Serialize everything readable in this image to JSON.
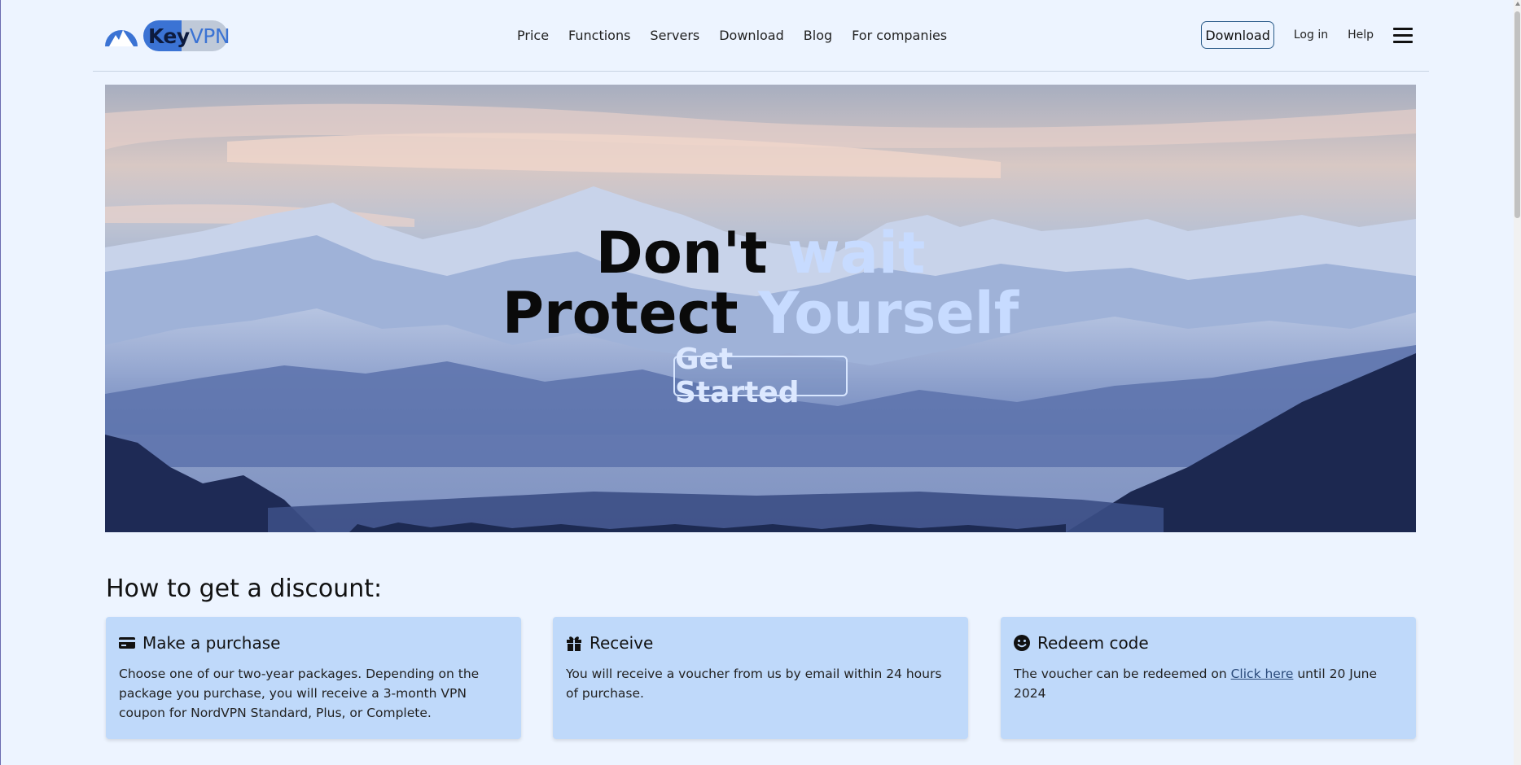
{
  "logo": {
    "key": "Key",
    "vpn": "VPN"
  },
  "nav": {
    "items": [
      "Price",
      "Functions",
      "Servers",
      "Download",
      "Blog",
      "For companies"
    ]
  },
  "right_nav": {
    "download": "Download",
    "login": "Log in",
    "help": "Help"
  },
  "hero": {
    "line1_a": "Don't ",
    "line1_b": "wait",
    "line2_a": "Protect ",
    "line2_b": "Yourself",
    "cta": "Get Started"
  },
  "discount": {
    "title": "How to get a discount:",
    "cards": [
      {
        "icon": "credit-card-icon",
        "title": "Make a purchase",
        "text": "Choose one of our two-year packages. Depending on the package you purchase, you will receive a 3-month VPN coupon for NordVPN Standard, Plus, or Complete."
      },
      {
        "icon": "gift-icon",
        "title": "Receive",
        "text": "You will receive a voucher from us by email within 24 hours of purchase."
      },
      {
        "icon": "smile-icon",
        "title": "Redeem code",
        "text_before": "The voucher can be redeemed on ",
        "link": "Click here",
        "text_after": " until 20 June 2024"
      }
    ]
  },
  "colors": {
    "background": "#edf4ff",
    "card": "#bfd9fa",
    "accent": "#3b73d4",
    "hero_light_text": "#c7dbff"
  }
}
